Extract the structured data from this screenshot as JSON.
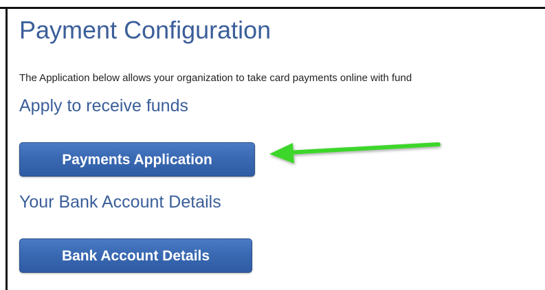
{
  "page": {
    "title": "Payment Configuration",
    "intro": "The Application below allows your organization to take card payments online with fund"
  },
  "sections": {
    "apply": {
      "heading": "Apply to receive funds",
      "button_label": "Payments Application"
    },
    "bank": {
      "heading": "Your Bank Account Details",
      "button_label": "Bank Account Details"
    }
  },
  "annotation": {
    "icon": "arrow-left-icon",
    "color": "#3dd62b"
  },
  "colors": {
    "heading": "#3a5e99",
    "button": "#3a69b3"
  }
}
